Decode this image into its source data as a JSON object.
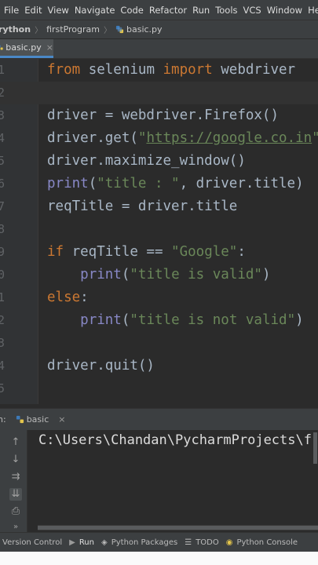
{
  "menubar": {
    "items": [
      "File",
      "Edit",
      "View",
      "Navigate",
      "Code",
      "Refactor",
      "Run",
      "Tools",
      "VCS",
      "Window",
      "Help"
    ]
  },
  "breadcrumb": {
    "project": "rython",
    "folder": "firstProgram",
    "file": "basic.py"
  },
  "tab": {
    "label": "basic.py",
    "close": "×"
  },
  "editor": {
    "line_numbers": [
      "1",
      "2",
      "3",
      "4",
      "5",
      "6",
      "7",
      "8",
      "9",
      "0",
      "1",
      "2",
      "3",
      "4",
      "5"
    ],
    "lines": [
      [
        {
          "t": "kw",
          "v": "from"
        },
        {
          "t": "n",
          "v": " selenium "
        },
        {
          "t": "kw",
          "v": "import"
        },
        {
          "t": "n",
          "v": " webdriver"
        }
      ],
      [],
      [
        {
          "t": "n",
          "v": "driver = webdriver.Firefox()"
        }
      ],
      [
        {
          "t": "n",
          "v": "driver.get("
        },
        {
          "t": "str",
          "v": "\""
        },
        {
          "t": "url",
          "v": "https://google.co.in"
        },
        {
          "t": "str",
          "v": "\""
        }
      ],
      [
        {
          "t": "n",
          "v": "driver.maximize_window()"
        }
      ],
      [
        {
          "t": "bi",
          "v": "print"
        },
        {
          "t": "n",
          "v": "("
        },
        {
          "t": "str",
          "v": "\"title : \""
        },
        {
          "t": "n",
          "v": ", driver.title)"
        }
      ],
      [
        {
          "t": "n",
          "v": "reqTitle = driver.title"
        }
      ],
      [],
      [
        {
          "t": "kw",
          "v": "if"
        },
        {
          "t": "n",
          "v": " reqTitle == "
        },
        {
          "t": "str",
          "v": "\"Google\""
        },
        {
          "t": "n",
          "v": ":"
        }
      ],
      [
        {
          "t": "n",
          "v": "    "
        },
        {
          "t": "bi",
          "v": "print"
        },
        {
          "t": "n",
          "v": "("
        },
        {
          "t": "str",
          "v": "\"title is valid\""
        },
        {
          "t": "n",
          "v": ")"
        }
      ],
      [
        {
          "t": "kw",
          "v": "else"
        },
        {
          "t": "n",
          "v": ":"
        }
      ],
      [
        {
          "t": "n",
          "v": "    "
        },
        {
          "t": "bi",
          "v": "print"
        },
        {
          "t": "n",
          "v": "("
        },
        {
          "t": "str",
          "v": "\"title is not valid\""
        },
        {
          "t": "n",
          "v": ")"
        }
      ],
      [],
      [
        {
          "t": "n",
          "v": "driver.quit()"
        }
      ],
      []
    ]
  },
  "run_panel": {
    "prefix": "n:",
    "tab_label": "basic",
    "tab_close": "×",
    "console_output": "C:\\Users\\Chandan\\PycharmProjects\\f"
  },
  "statusbar": {
    "items": [
      {
        "icon": "branch-icon",
        "label": "Version Control"
      },
      {
        "icon": "run-icon",
        "label": "Run"
      },
      {
        "icon": "packages-icon",
        "label": "Python Packages"
      },
      {
        "icon": "todo-icon",
        "label": "TODO"
      },
      {
        "icon": "python-console-icon",
        "label": "Python Console"
      }
    ]
  },
  "colors": {
    "keyword": "#cc7832",
    "string": "#6a8759",
    "builtin": "#8888c6",
    "text": "#a9b7c6",
    "background": "#2b2b2b"
  }
}
